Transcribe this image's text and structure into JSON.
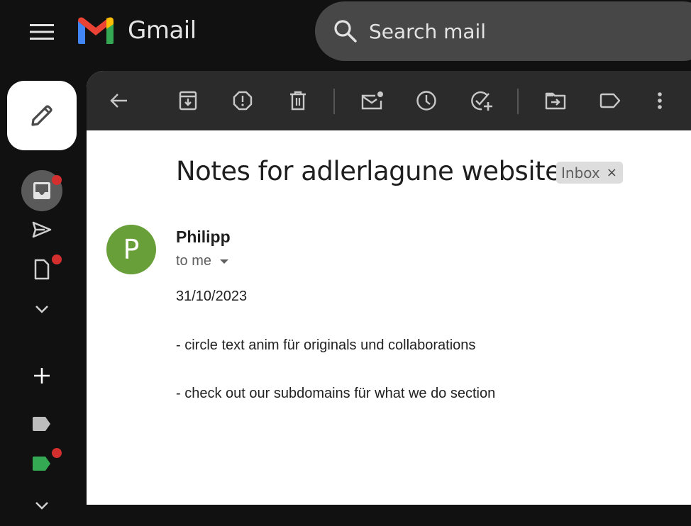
{
  "app": {
    "name": "Gmail"
  },
  "search": {
    "placeholder": "Search mail",
    "value": ""
  },
  "sidebar": {
    "compose_label": "Compose",
    "items": [
      {
        "name": "inbox",
        "icon": "inbox-icon",
        "active": true,
        "badge": true
      },
      {
        "name": "sent",
        "icon": "send-icon",
        "active": false,
        "badge": false
      },
      {
        "name": "drafts",
        "icon": "draft-icon",
        "active": false,
        "badge": true
      },
      {
        "name": "more",
        "icon": "chevron-down-icon",
        "active": false,
        "badge": false
      },
      {
        "name": "create-label",
        "icon": "plus-icon",
        "active": false,
        "badge": false
      },
      {
        "name": "label-gray",
        "icon": "label-icon",
        "color": "#bdbdbd",
        "badge": false
      },
      {
        "name": "label-green",
        "icon": "label-icon",
        "color": "#34a853",
        "badge": true
      },
      {
        "name": "more-labels",
        "icon": "chevron-down-icon",
        "badge": false
      }
    ]
  },
  "toolbar": {
    "buttons": [
      "back",
      "archive",
      "report-spam",
      "delete",
      "mark-unread",
      "snooze",
      "add-to-tasks",
      "move-to",
      "labels",
      "more"
    ]
  },
  "email": {
    "subject": "Notes for adlerlagune website",
    "label_chip": "Inbox",
    "chip_close": "×",
    "sender": "Philipp",
    "avatar_letter": "P",
    "avatar_color": "#689f38",
    "recipient": "to me",
    "body": [
      "31/10/2023",
      "- circle text anim für originals und collaborations",
      "- check out our subdomains für what we do section"
    ]
  },
  "colors": {
    "badge": "#d32f2f",
    "toolbar_bg": "#2b2b2b",
    "app_bg": "#111111"
  }
}
